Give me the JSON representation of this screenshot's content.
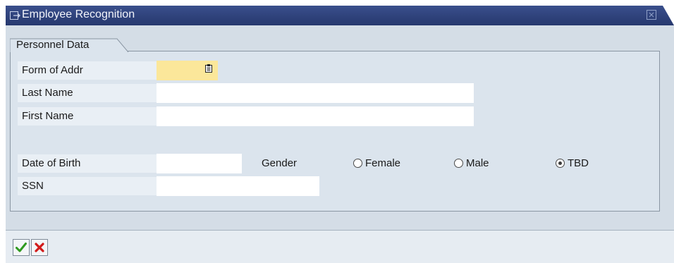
{
  "window": {
    "title": "Employee Recognition"
  },
  "tab": {
    "label": "Personnel Data"
  },
  "form": {
    "form_of_addr_label": "Form of Addr",
    "last_name_label": "Last Name",
    "first_name_label": "First Name",
    "date_of_birth_label": "Date of Birth",
    "ssn_label": "SSN",
    "gender_label": "Gender",
    "gender_options": [
      {
        "label": "Female",
        "selected": false
      },
      {
        "label": "Male",
        "selected": false
      },
      {
        "label": "TBD",
        "selected": true
      }
    ],
    "form_of_addr_value": "",
    "last_name_value": "",
    "first_name_value": "",
    "date_of_birth_value": "",
    "ssn_value": ""
  },
  "icons": {
    "title": "window-icon",
    "close": "close-icon",
    "f4": "value-help-icon",
    "ok": "checkmark-icon",
    "cancel": "cancel-x-icon"
  },
  "colors": {
    "titlebar": "#2e417a",
    "required_field": "#fbe79a",
    "ok_green": "#2f9a1f",
    "cancel_red": "#d11a1a"
  }
}
